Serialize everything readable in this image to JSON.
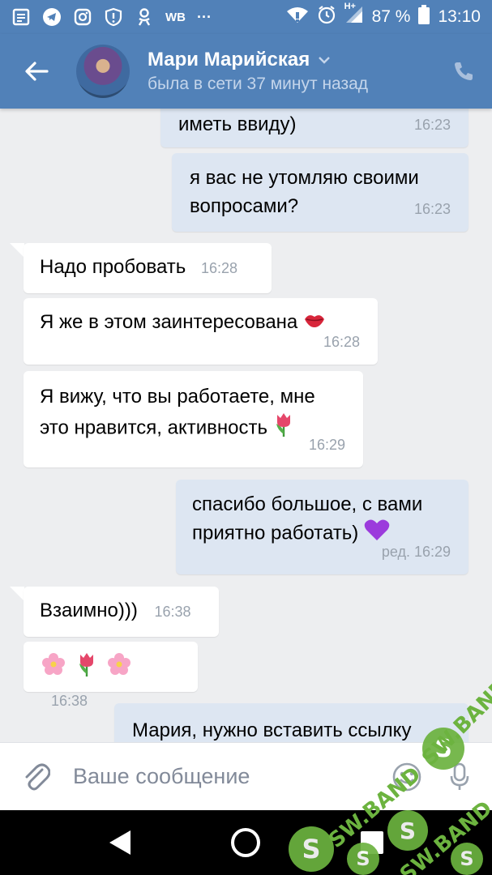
{
  "status_bar": {
    "battery": "87 %",
    "time": "13:10",
    "network_label": "WB",
    "more": "···",
    "net_type": "H+"
  },
  "header": {
    "contact_name": "Мари Марийская",
    "contact_status": "была в сети 37 минут назад"
  },
  "messages": [
    {
      "dir": "out",
      "text": "иметь ввиду)",
      "time": "16:23"
    },
    {
      "dir": "out",
      "lines": [
        "я вас не утомляю своими",
        "вопросами?"
      ],
      "time": "16:23"
    },
    {
      "dir": "in",
      "text": "Надо пробовать",
      "time": "16:28"
    },
    {
      "dir": "in",
      "text": "Я же в этом заинтересована",
      "emoji": "kiss-lips",
      "time": "16:28"
    },
    {
      "dir": "in",
      "lines": [
        "Я вижу, что вы работаете, мне",
        "это нравится, активность"
      ],
      "emoji": "tulip",
      "time": "16:29"
    },
    {
      "dir": "out",
      "lines": [
        "спасибо большое, с вами",
        "приятно работать)"
      ],
      "emoji": "purple-heart",
      "time": "ред. 16:29"
    },
    {
      "dir": "in",
      "text": "Взаимно)))",
      "time": "16:38"
    },
    {
      "dir": "in",
      "emojis": [
        "cherry-blossom",
        "tulip",
        "cherry-blossom"
      ],
      "time": "16:38"
    },
    {
      "dir": "out",
      "text": "Мария, нужно вставить ссылку"
    }
  ],
  "composer": {
    "placeholder": "Ваше сообщение"
  },
  "watermark": {
    "text": "SW.BAND",
    "letter": "S"
  },
  "colors": {
    "header": "#5181b8",
    "outgoing_bubble": "#dde6f2",
    "incoming_bubble": "#ffffff",
    "background": "#edeef0",
    "watermark": "#6cb33f"
  }
}
